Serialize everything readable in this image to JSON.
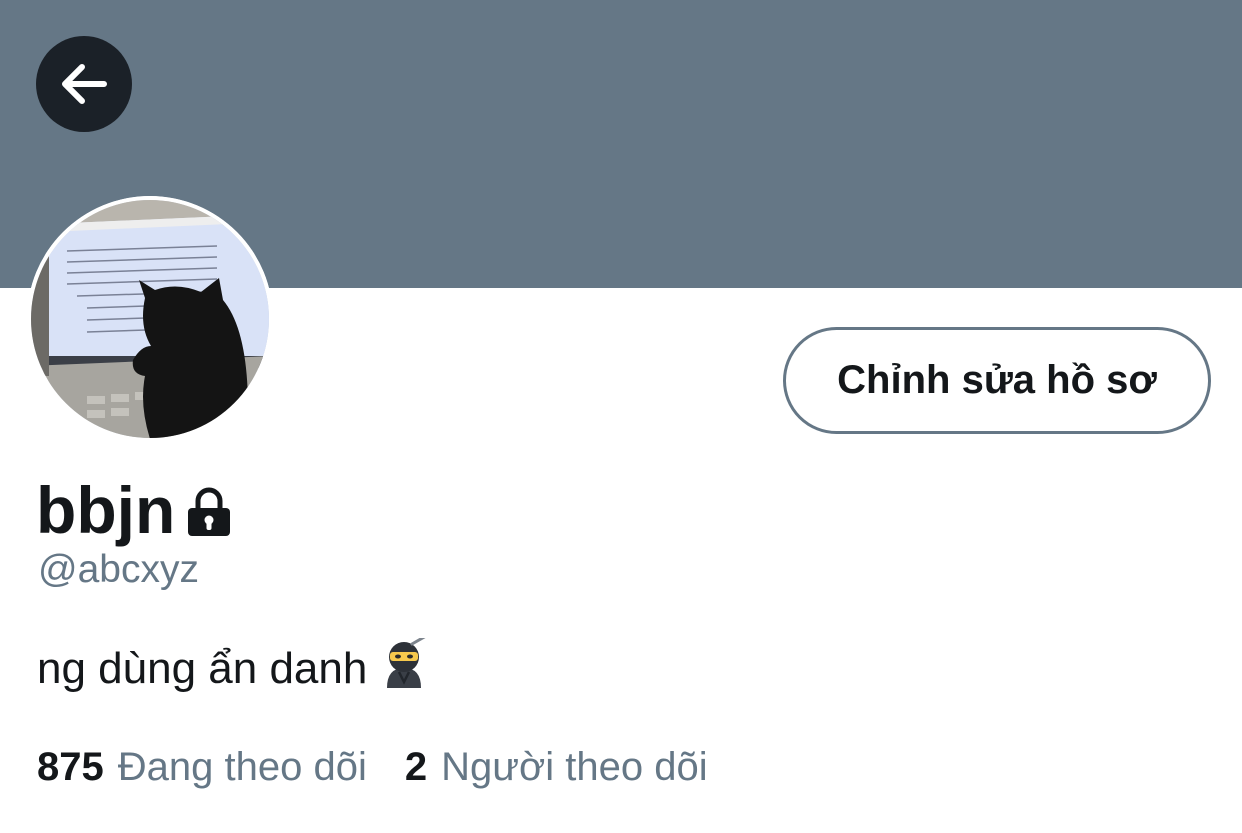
{
  "colors": {
    "banner": "#657786",
    "back_button": "#1b2128",
    "primary_text": "#14171a",
    "secondary_text": "#657786",
    "button_border": "#657786"
  },
  "header": {
    "back_icon": "arrow-left-icon"
  },
  "profile": {
    "edit_button_label": "Chỉnh sửa hồ sơ",
    "display_name": "bbjn",
    "lock_icon": "lock-icon",
    "handle": "@abcxyz",
    "bio": "ng dùng ẩn danh",
    "bio_emoji_icon": "ninja-emoji-icon"
  },
  "stats": {
    "following_count": "875",
    "following_label": "Đang theo dõi",
    "followers_count": "2",
    "followers_label": "Người theo dõi"
  }
}
